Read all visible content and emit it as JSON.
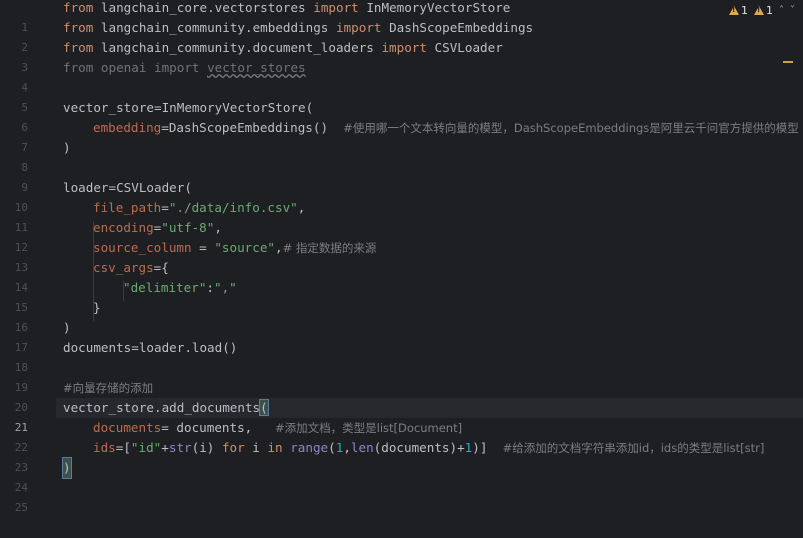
{
  "status": {
    "warning_count_a": "1",
    "warning_count_b": "1",
    "warning_color": "#e0a84a",
    "icon_up": "chevron-up-icon",
    "icon_down": "chevron-down-icon"
  },
  "lines": [
    {
      "n": "1"
    },
    {
      "n": "2"
    },
    {
      "n": "3"
    },
    {
      "n": "4"
    },
    {
      "n": "5"
    },
    {
      "n": "6"
    },
    {
      "n": "7"
    },
    {
      "n": "8"
    },
    {
      "n": "9"
    },
    {
      "n": "10"
    },
    {
      "n": "11"
    },
    {
      "n": "12"
    },
    {
      "n": "13"
    },
    {
      "n": "14"
    },
    {
      "n": "15"
    },
    {
      "n": "16"
    },
    {
      "n": "17"
    },
    {
      "n": "18"
    },
    {
      "n": "19"
    },
    {
      "n": "20"
    },
    {
      "n": "21"
    },
    {
      "n": "22"
    },
    {
      "n": "23"
    },
    {
      "n": "24"
    },
    {
      "n": "25"
    }
  ],
  "code": {
    "l1": {
      "kw1": "from",
      "mod": " langchain_core.vectorstores ",
      "kw2": "import",
      "name": " InMemoryVectorStore"
    },
    "l2": {
      "kw1": "from",
      "mod": " langchain_community.embeddings ",
      "kw2": "import",
      "name": " DashScopeEmbeddings"
    },
    "l3": {
      "kw1": "from",
      "mod": " langchain_community.document_loaders ",
      "kw2": "import",
      "name": " CSVLoader"
    },
    "l4": {
      "a": "from openai import ",
      "b": "vector_stores"
    },
    "l6": "vector_store=InMemoryVectorStore(",
    "l7": {
      "param": "embedding",
      "rest": "=DashScopeEmbeddings()  ",
      "com": "#使用哪一个文本转向量的模型，DashScopeEmbeddings是阿里云千问官方提供的模型"
    },
    "l8": ")",
    "l10": "loader=CSVLoader(",
    "l11": {
      "param": "file_path",
      "eq": "=",
      "str": "\"./data/info.csv\"",
      "rest": ","
    },
    "l12": {
      "param": "encoding",
      "eq": "=",
      "str": "\"utf-8\"",
      "rest": ","
    },
    "l13": {
      "param": "source_column",
      "eq": " = ",
      "str": "\"source\"",
      "rest": ",",
      "com": "# 指定数据的来源"
    },
    "l14": {
      "param": "csv_args",
      "rest": "={"
    },
    "l15": {
      "str1": "\"delimiter\"",
      "mid": ":",
      "str2": "\",\""
    },
    "l16": "}",
    "l17": ")",
    "l18": "documents=loader.load()",
    "l20": "#向量存储的添加",
    "l21": {
      "a": "vector_store.add_documents",
      "b": "("
    },
    "l22": {
      "param": "documents",
      "rest": "= documents,   ",
      "com": "#添加文档，类型是list[Document]"
    },
    "l23": {
      "param": "ids",
      "p1": "=[",
      "s1": "\"id\"",
      "p2": "+",
      "b1": "str",
      "p3": "(i) ",
      "k1": "for",
      "p4": " i ",
      "k2": "in",
      "p5": " ",
      "b2": "range",
      "p6": "(",
      "n1": "1",
      "p7": ",",
      "b3": "len",
      "p8": "(documents)+",
      "n2": "1",
      "p9": ")]  ",
      "com": "#给添加的文档字符串添加id，ids的类型是list[str]"
    },
    "l24": ")"
  }
}
